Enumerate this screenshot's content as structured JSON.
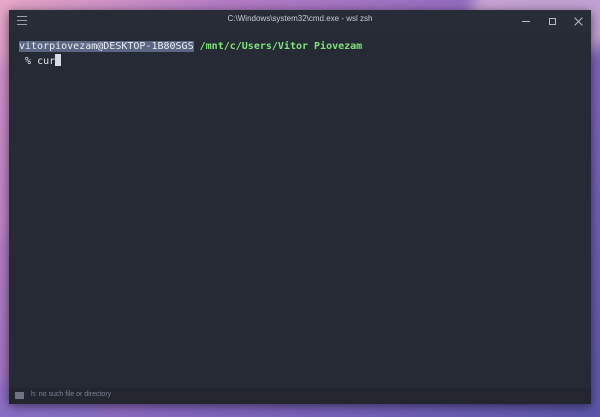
{
  "window": {
    "title": "C:\\Windows\\system32\\cmd.exe - wsl  zsh"
  },
  "terminal": {
    "prompt_user_host": "vitorpiovezam@DESKTOP-1B80SGS",
    "prompt_path": "/mnt/c/Users/Vitor Piovezam",
    "prompt_symbol": "%",
    "command_input": "cur"
  },
  "statusbar": {
    "message": "h: no such file or directory"
  },
  "colors": {
    "terminal_bg": "#262a35",
    "path_green": "#7fe37a",
    "selection": "#5b6782"
  },
  "icons": {
    "menu": "hamburger-menu-icon",
    "minimize": "minimize-icon",
    "maximize": "maximize-icon",
    "close": "close-icon",
    "status": "folder-icon"
  }
}
